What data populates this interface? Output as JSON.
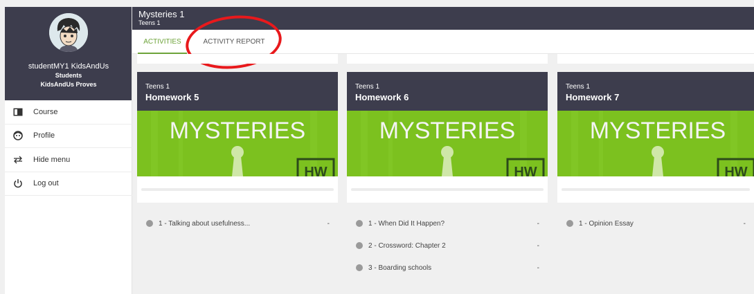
{
  "header": {
    "title": "Mysteries 1",
    "subtitle": "Teens 1"
  },
  "tabs": [
    {
      "label": "ACTIVITIES",
      "active": true
    },
    {
      "label": "ACTIVITY REPORT",
      "active": false
    }
  ],
  "user": {
    "name": "studentMY1 KidsAndUs",
    "role": "Students",
    "school": "KidsAndUs Proves"
  },
  "menu": [
    {
      "label": "Course",
      "icon": "book-icon"
    },
    {
      "label": "Profile",
      "icon": "profile-icon"
    },
    {
      "label": "Hide menu",
      "icon": "swap-arrows-icon"
    },
    {
      "label": "Log out",
      "icon": "power-icon"
    }
  ],
  "banner": {
    "logo_text": "MYSTERIES",
    "badge": "HW"
  },
  "cards": [
    {
      "level": "Teens 1",
      "title": "Homework 5",
      "activities": [
        {
          "name": "1 - Talking about usefulness...",
          "score": "-"
        }
      ]
    },
    {
      "level": "Teens 1",
      "title": "Homework 6",
      "activities": [
        {
          "name": "1 - When Did It Happen?",
          "score": "-"
        },
        {
          "name": "2 - Crossword: Chapter 2",
          "score": "-"
        },
        {
          "name": "3 - Boarding schools",
          "score": "-"
        }
      ]
    },
    {
      "level": "Teens 1",
      "title": "Homework 7",
      "activities": [
        {
          "name": "1 - Opinion Essay",
          "score": "-"
        }
      ]
    }
  ],
  "colors": {
    "header_bg": "#3d3d4d",
    "accent_green": "#6da339",
    "banner_green": "#7cc11f",
    "annotation_red": "#e8191c"
  }
}
